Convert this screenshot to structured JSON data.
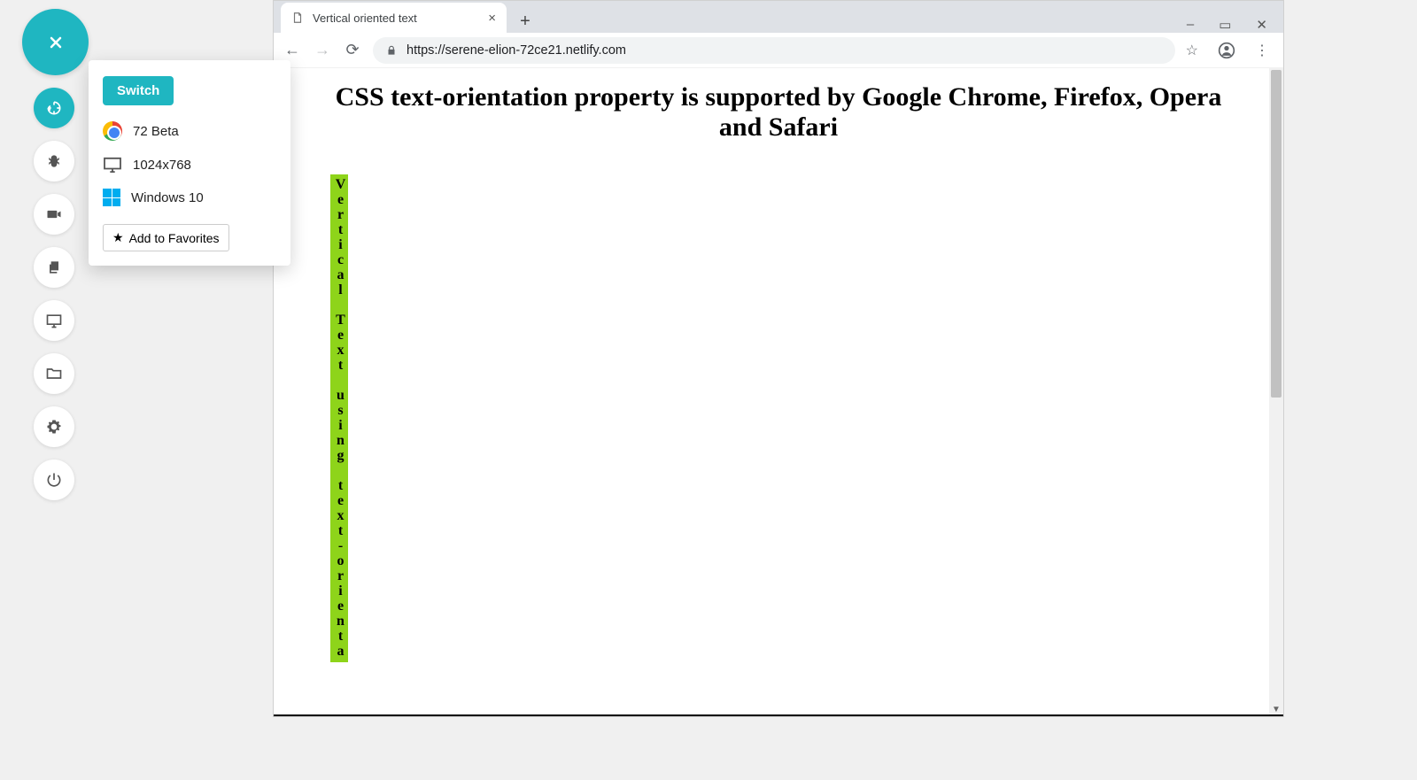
{
  "leftRail": {
    "close_tooltip": "Close",
    "items": [
      "session-icon",
      "bug-icon",
      "video-icon",
      "copy-icon",
      "screen-icon",
      "folder-icon",
      "gear-icon",
      "power-icon"
    ]
  },
  "popover": {
    "switch_label": "Switch",
    "browser_version": "72 Beta",
    "resolution": "1024x768",
    "os": "Windows 10",
    "fav_label": "Add to Favorites"
  },
  "browser": {
    "tab_title": "Vertical oriented text",
    "url": "https://serene-elion-72ce21.netlify.com",
    "window_controls": {
      "minimize": "–",
      "maximize": "▭",
      "close": "✕"
    }
  },
  "page": {
    "heading": "CSS text-orientation property is supported by Google Chrome, Firefox, Opera and Safari",
    "vertical_text": "Vertical Text using text-orienta"
  }
}
